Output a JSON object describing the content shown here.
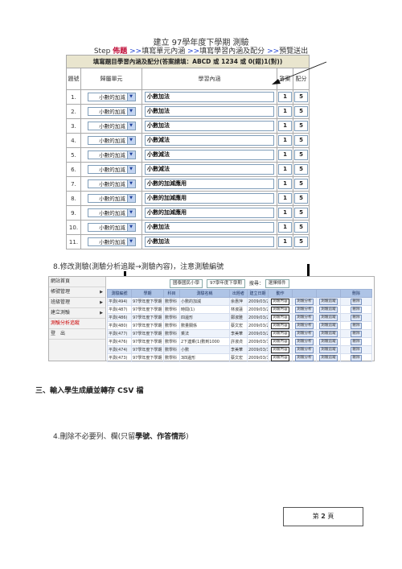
{
  "form": {
    "title": "建立 97學年度下學期 測驗",
    "steps": {
      "prefix": "Step",
      "current": "佈題",
      "sep": ">>",
      "step2": "填寫單元內涵",
      "step3": "填寫學習內涵及配分",
      "step4": "預覽送出"
    },
    "banner": "填寫題目學習內涵及配分(答案請填：ABCD 或 1234 或 0(錯)1(對))",
    "headers": {
      "number": "題號",
      "unit": "歸屬單元",
      "content": "學習內涵",
      "answer": "答案",
      "score": "配分"
    },
    "rows": [
      {
        "num": "1.",
        "unit": "小數的加減",
        "content": "小數加法",
        "answer": "1",
        "score": "5"
      },
      {
        "num": "2.",
        "unit": "小數的加減",
        "content": "小數加法",
        "answer": "1",
        "score": "5"
      },
      {
        "num": "3.",
        "unit": "小數的加減",
        "content": "小數加法",
        "answer": "1",
        "score": "5"
      },
      {
        "num": "4.",
        "unit": "小數的加減",
        "content": "小數減法",
        "answer": "1",
        "score": "5"
      },
      {
        "num": "5.",
        "unit": "小數的加減",
        "content": "小數減法",
        "answer": "1",
        "score": "5"
      },
      {
        "num": "6.",
        "unit": "小數的加減",
        "content": "小數減法",
        "answer": "1",
        "score": "5"
      },
      {
        "num": "7.",
        "unit": "小數的加減",
        "content": "小數的加減應用",
        "answer": "1",
        "score": "5"
      },
      {
        "num": "8.",
        "unit": "小數的加減",
        "content": "小數的加減應用",
        "answer": "1",
        "score": "5"
      },
      {
        "num": "9.",
        "unit": "小數的加減",
        "content": "小數的加減應用",
        "answer": "1",
        "score": "5"
      },
      {
        "num": "10.",
        "unit": "小數的加減",
        "content": "小數加法",
        "answer": "1",
        "score": "5"
      },
      {
        "num": "11.",
        "unit": "小數的加減",
        "content": "小數加法",
        "answer": "1",
        "score": "5"
      }
    ]
  },
  "item8": "8.修改測驗(測驗分析追蹤→測驗內容)，注意測驗編號",
  "mgmt": {
    "sidebar": [
      {
        "label": "網站首頁",
        "arrow": ""
      },
      {
        "label": "帳號管理",
        "arrow": "▶"
      },
      {
        "label": "班級管理",
        "arrow": "▶"
      },
      {
        "label": "建立測驗",
        "arrow": "▶"
      },
      {
        "label": "測驗分析追蹤",
        "arrow": ""
      },
      {
        "label": "登　出",
        "arrow": ""
      }
    ],
    "toolbar": {
      "school": "國泰國民小學",
      "term": "97學年度下學期",
      "search_label": "搜尋：",
      "search_value": "選擇條件"
    },
    "headers": [
      "測驗編號",
      "學期",
      "科目",
      "測驗名稱",
      "出題者",
      "建立日期",
      "動作",
      "",
      "",
      "刪除"
    ],
    "rows": [
      {
        "id": "平測(494)",
        "term": "97學年度下學期",
        "subject": "數學科",
        "name": "小數的加減",
        "author": "余惠萍",
        "date": "2009/03/26"
      },
      {
        "id": "平測(487)",
        "term": "97學年度下學期",
        "subject": "數學科",
        "name": "時間(1)",
        "author": "林淑蓮",
        "date": "2009/03/24"
      },
      {
        "id": "平測(486)",
        "term": "97學年度下學期",
        "subject": "數學科",
        "name": "四邊形",
        "author": "鄭淑雅",
        "date": "2009/03/23"
      },
      {
        "id": "平測(480)",
        "term": "97學年度下學期",
        "subject": "數學科",
        "name": "數量關係",
        "author": "蔡文宏",
        "date": "2009/03/23"
      },
      {
        "id": "平測(477)",
        "term": "97學年度下學期",
        "subject": "數學科",
        "name": "乘法",
        "author": "李美華",
        "date": "2009/03/20"
      },
      {
        "id": "平測(476)",
        "term": "97學年度下學期",
        "subject": "數學科",
        "name": "2下連乘(1)數到1000",
        "author": "許淑貞",
        "date": "2009/03/19"
      },
      {
        "id": "平測(474)",
        "term": "97學年度下學期",
        "subject": "數學科",
        "name": "小數",
        "author": "李美華",
        "date": "2009/03/19"
      },
      {
        "id": "平測(473)",
        "term": "97學年度下學期",
        "subject": "數學科",
        "name": "3四邊形",
        "author": "蔡文宏",
        "date": "2009/03/17"
      }
    ],
    "actions": {
      "content": "測驗內容",
      "analysis": "測驗分析",
      "status": "測驗追蹤",
      "delete": "刪除"
    }
  },
  "section3": "三、輸入學生成績並轉存 CSV 檔",
  "item4": {
    "prefix": "4.刪除不必要列、欄(只留",
    "bold": "學號、作答情形",
    "suffix": ")"
  },
  "page": {
    "prefix": "第",
    "number": "2",
    "suffix": "頁"
  }
}
